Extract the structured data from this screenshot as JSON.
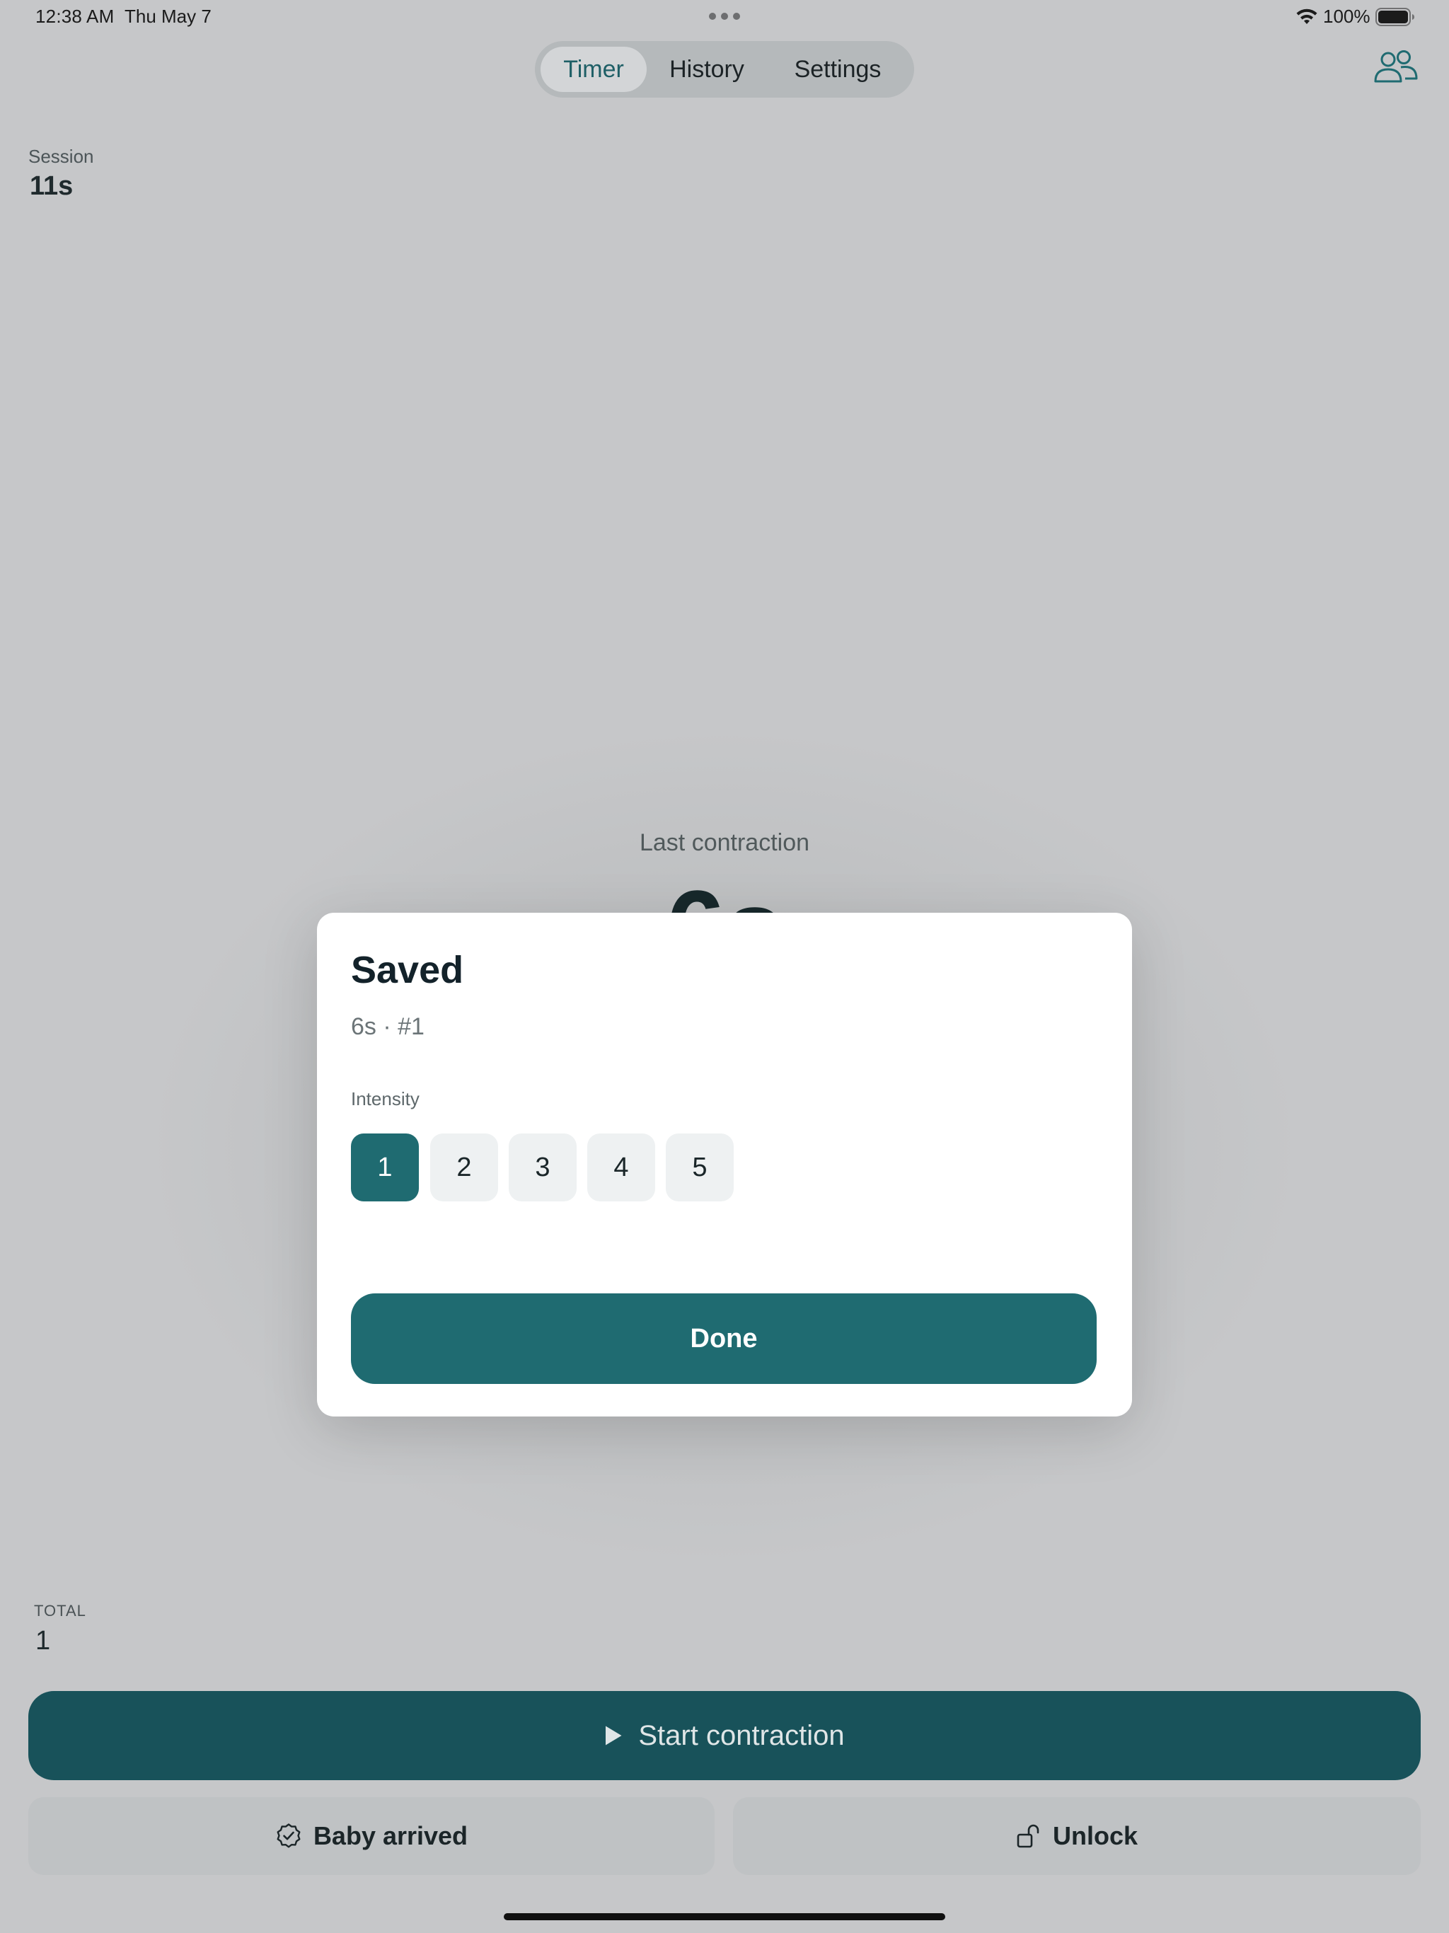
{
  "status_bar": {
    "time": "12:38 AM",
    "date": "Thu May 7",
    "battery": "100%"
  },
  "tabs": [
    {
      "label": "Timer",
      "active": true
    },
    {
      "label": "History",
      "active": false
    },
    {
      "label": "Settings",
      "active": false
    }
  ],
  "session": {
    "label": "Session",
    "value": "11s"
  },
  "last_contraction": {
    "label": "Last contraction",
    "value": "6s"
  },
  "modal": {
    "title": "Saved",
    "subtitle": "6s · #1",
    "intensity_label": "Intensity",
    "intensity_options": [
      "1",
      "2",
      "3",
      "4",
      "5"
    ],
    "selected_intensity": "1",
    "done_label": "Done"
  },
  "total": {
    "label": "TOTAL",
    "value": "1"
  },
  "actions": {
    "start_label": "Start contraction",
    "baby_label": "Baby arrived",
    "unlock_label": "Unlock"
  },
  "colors": {
    "accent": "#1f6b71",
    "accent_dark": "#18525a",
    "background": "#c6c7c9"
  },
  "icons": {
    "people": "people-icon",
    "play": "play-icon",
    "badge_check": "badge-check-icon",
    "unlock": "unlock-icon",
    "wifi": "wifi-icon",
    "battery": "battery-icon"
  }
}
